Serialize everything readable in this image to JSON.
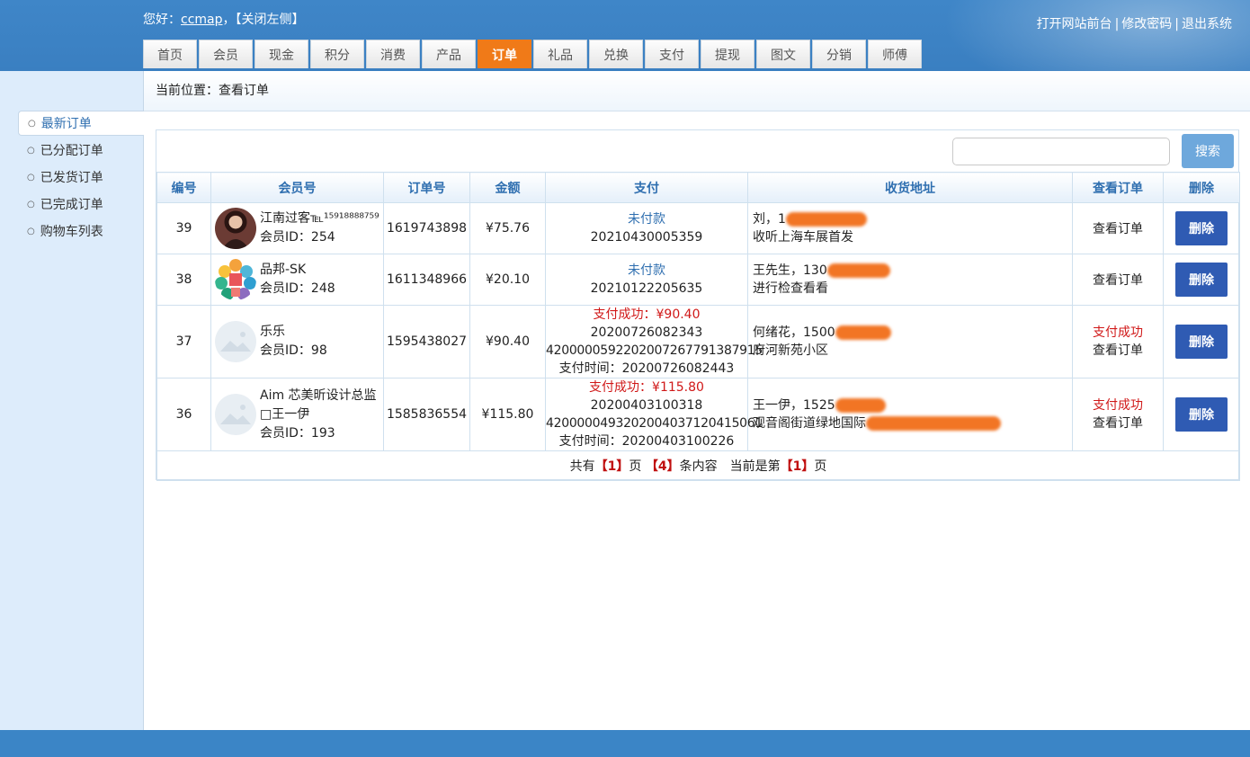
{
  "header": {
    "greeting_prefix": "您好：",
    "username": "ccmap",
    "greeting_suffix": "，",
    "close_left": "【关闭左侧】",
    "links": [
      "打开网站前台",
      "修改密码",
      "退出系统"
    ]
  },
  "tabs": [
    "首页",
    "会员",
    "现金",
    "积分",
    "消费",
    "产品",
    "订单",
    "礼品",
    "兑换",
    "支付",
    "提现",
    "图文",
    "分销",
    "师傅"
  ],
  "active_tab": "订单",
  "sidebar": {
    "items": [
      "最新订单",
      "已分配订单",
      "已发货订单",
      "已完成订单",
      "购物车列表"
    ],
    "active": "最新订单"
  },
  "breadcrumb": "当前位置：查看订单",
  "search": {
    "placeholder": "",
    "button": "搜索"
  },
  "table": {
    "headers": [
      "编号",
      "会员号",
      "订单号",
      "金额",
      "支付",
      "收货地址",
      "查看订单",
      "删除"
    ],
    "rows": [
      {
        "id": "39",
        "member_name": "江南过客℡¹⁵⁹¹⁸⁸⁸⁸⁷⁵⁹",
        "member_id": "会员ID：254",
        "avatar": "photo-avatar",
        "order_no": "1619743898",
        "amount": "¥75.76",
        "pay_status": "未付款",
        "pay_lines": [
          "20210430005359"
        ],
        "addr_name": "刘，1",
        "addr_detail": "收听上海车展首发",
        "view_status": "",
        "view": "查看订单",
        "delete": "删除"
      },
      {
        "id": "38",
        "member_name": "品邦-SK",
        "member_id": "会员ID：248",
        "avatar": "logo-avatar",
        "order_no": "1611348966",
        "amount": "¥20.10",
        "pay_status": "未付款",
        "pay_lines": [
          "20210122205635"
        ],
        "addr_name": "王先生，130",
        "addr_detail": "进行检查看看",
        "view_status": "",
        "view": "查看订单",
        "delete": "删除"
      },
      {
        "id": "37",
        "member_name": "乐乐",
        "member_id": "会员ID：98",
        "avatar": "placeholder-avatar",
        "order_no": "1595438027",
        "amount": "¥90.40",
        "pay_status": "支付成功：¥90.40",
        "pay_lines": [
          "20200726082343",
          "4200000592202007267791387915",
          "支付时间：20200726082443"
        ],
        "addr_name": "何绪花，1500",
        "addr_detail": "府河新苑小区",
        "view_status": "支付成功",
        "view": "查看订单",
        "delete": "删除"
      },
      {
        "id": "36",
        "member_name": "Aim 芯美昕设计总监",
        "member_name2": "□王一伊",
        "member_id": "会员ID：193",
        "avatar": "placeholder-avatar",
        "order_no": "1585836554",
        "amount": "¥115.80",
        "pay_status": "支付成功：¥115.80",
        "pay_lines": [
          "20200403100318",
          "4200000493202004037120415061",
          "支付时间：20200403100226"
        ],
        "addr_name": "王一伊，1525",
        "addr_detail": "观音阁街道绿地国际",
        "view_status": "支付成功",
        "view": "查看订单",
        "delete": "删除"
      }
    ]
  },
  "pager": {
    "t1": "共有",
    "pages": "【1】",
    "t2": "页",
    "count": "【4】",
    "t3": "条内容　当前是第",
    "current": "【1】",
    "t4": "页"
  },
  "colors": {
    "header": "#3b85c6",
    "active_tab": "#f07a18",
    "delete_button": "#2f5bb3",
    "link_blue": "#2f6fb0",
    "paid_red": "#d01818"
  }
}
